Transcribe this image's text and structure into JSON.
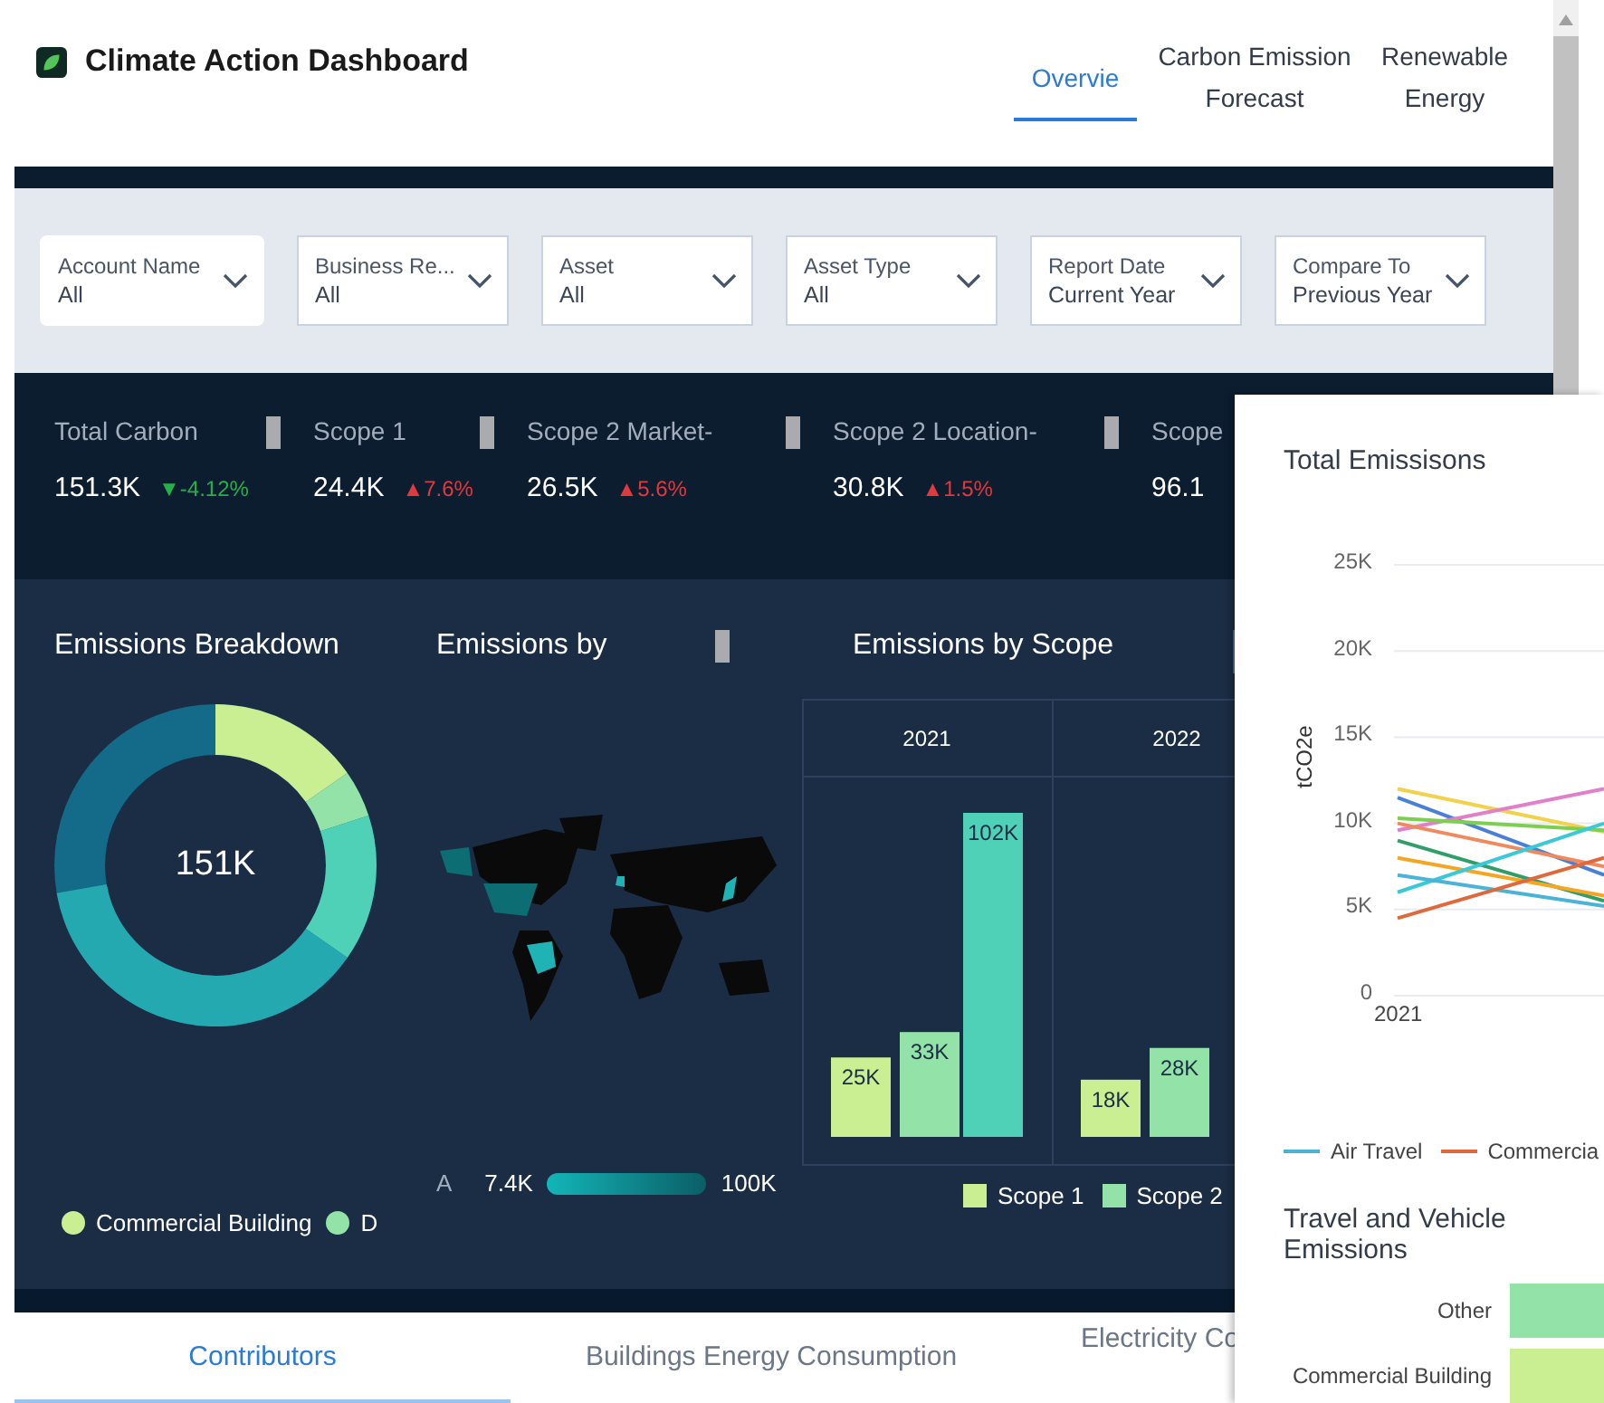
{
  "header": {
    "title": "Climate Action Dashboard",
    "tabs": [
      {
        "label": "Overvie",
        "selected": true
      },
      {
        "label": "Carbon Emission Forecast",
        "selected": false
      },
      {
        "label": "Renewable Energy",
        "selected": false
      }
    ]
  },
  "filters": [
    {
      "label": "Account Name",
      "value": "All",
      "focused": true
    },
    {
      "label": "Business Re...",
      "value": "All",
      "focused": false
    },
    {
      "label": "Asset",
      "value": "All",
      "focused": false
    },
    {
      "label": "Asset Type",
      "value": "All",
      "focused": false
    },
    {
      "label": "Report Date",
      "value": "Current Year",
      "focused": false
    },
    {
      "label": "Compare To",
      "value": "Previous Year",
      "focused": false
    }
  ],
  "kpis": [
    {
      "label": "Total Carbon",
      "value": "151.3K",
      "change": "▼-4.12%",
      "color": "#27b04a"
    },
    {
      "label": "Scope 1",
      "value": "24.4K",
      "change": "▲7.6%",
      "color": "#e0393e"
    },
    {
      "label": "Scope 2 Market-",
      "value": "26.5K",
      "change": "▲5.6%",
      "color": "#e0393e"
    },
    {
      "label": "Scope 2 Location-",
      "value": "30.8K",
      "change": "▲1.5%",
      "color": "#e0393e"
    },
    {
      "label": "Scope",
      "value": "96.1"
    }
  ],
  "breakdown": {
    "title": "Emissions Breakdown",
    "center": "151K",
    "legend": [
      {
        "label": "Commercial Building",
        "color": "#c9ef92"
      },
      {
        "label": "D",
        "color": "#93e3a8"
      }
    ]
  },
  "map": {
    "title": "Emissions by",
    "legend_label": "A",
    "min": "7.4K",
    "max": "100K"
  },
  "scope_chart": {
    "title": "Emissions by Scope",
    "chart_data": {
      "type": "bar",
      "categories": [
        "2021",
        "2022"
      ],
      "series": [
        {
          "name": "Scope 1",
          "color": "#c9ef92",
          "values": [
            25000,
            18000
          ],
          "value_labels": [
            "25K",
            "18K"
          ]
        },
        {
          "name": "Scope 2",
          "color": "#93e3a8",
          "values": [
            33000,
            28000
          ],
          "value_labels": [
            "33K",
            "28K"
          ]
        },
        {
          "color": "#4fd1b8",
          "values": [
            102000,
            null
          ],
          "value_labels": [
            "102K",
            null
          ]
        }
      ],
      "data_labels": true
    }
  },
  "bottom_tabs": [
    {
      "label": "Contributors",
      "selected": true
    },
    {
      "label": "Buildings Energy Consumption",
      "selected": false
    },
    {
      "label": "Electricity Co",
      "selected": false
    }
  ],
  "overlay": {
    "title": "Total Emissisons",
    "y_label": "tCO2e",
    "y_ticks": [
      "25K",
      "20K",
      "15K",
      "10K",
      "5K",
      "0"
    ],
    "x_tick": "2021",
    "legend": [
      {
        "label": "Air Travel",
        "color": "#4bb3d6"
      },
      {
        "label": "Commercia",
        "color": "#e0683a"
      }
    ],
    "bars_title": "Travel and Vehicle Emissions",
    "bars": [
      {
        "label": "Other",
        "color": "#93e3a8"
      },
      {
        "label": "Commercial Building",
        "color": "#c9ef92"
      }
    ]
  }
}
